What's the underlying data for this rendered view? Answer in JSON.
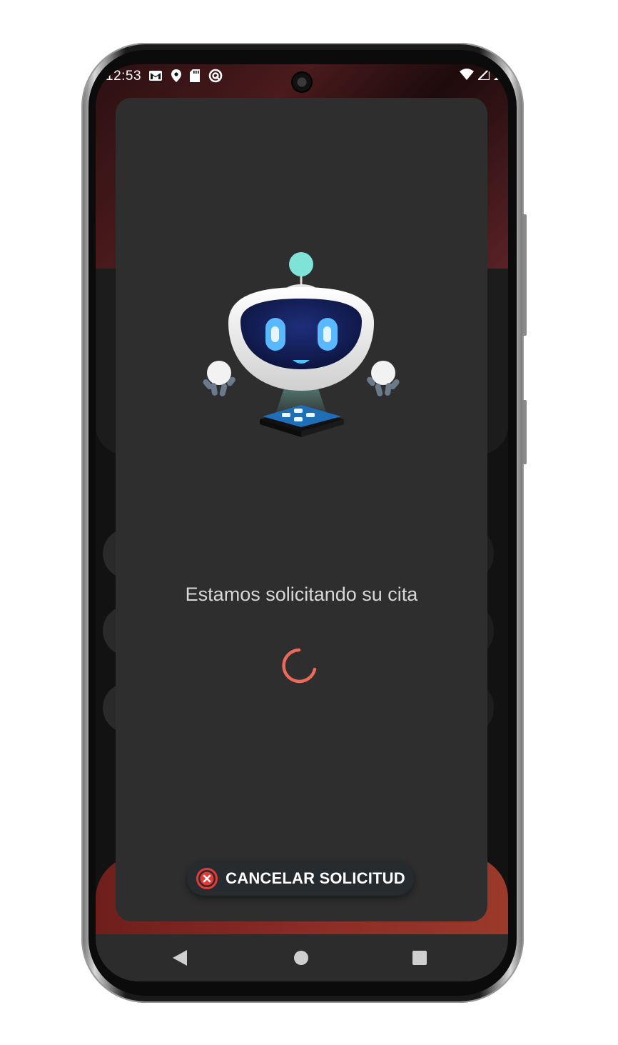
{
  "status_bar": {
    "time": "12:53",
    "left_icons": [
      "gmail-icon",
      "location-pin-icon",
      "sd-card-icon",
      "sync-icon"
    ],
    "right_icons": [
      "wifi-icon",
      "signal-icon",
      "battery-icon"
    ]
  },
  "dialog": {
    "illustration": "robot-icon",
    "message": "Estamos solicitando su cita",
    "spinner": "loading-spinner",
    "spinner_color": "#EC6A5A",
    "cancel_button": {
      "label": "CANCELAR SOLICITUD",
      "icon": "close-circle-icon",
      "icon_color": "#E53935"
    }
  },
  "navigation_bar": {
    "buttons": [
      "back-icon",
      "home-icon",
      "recents-icon"
    ]
  },
  "colors": {
    "dialog_background": "#2E2E2E",
    "button_background": "#262B30",
    "text": "#D8D8D8"
  }
}
